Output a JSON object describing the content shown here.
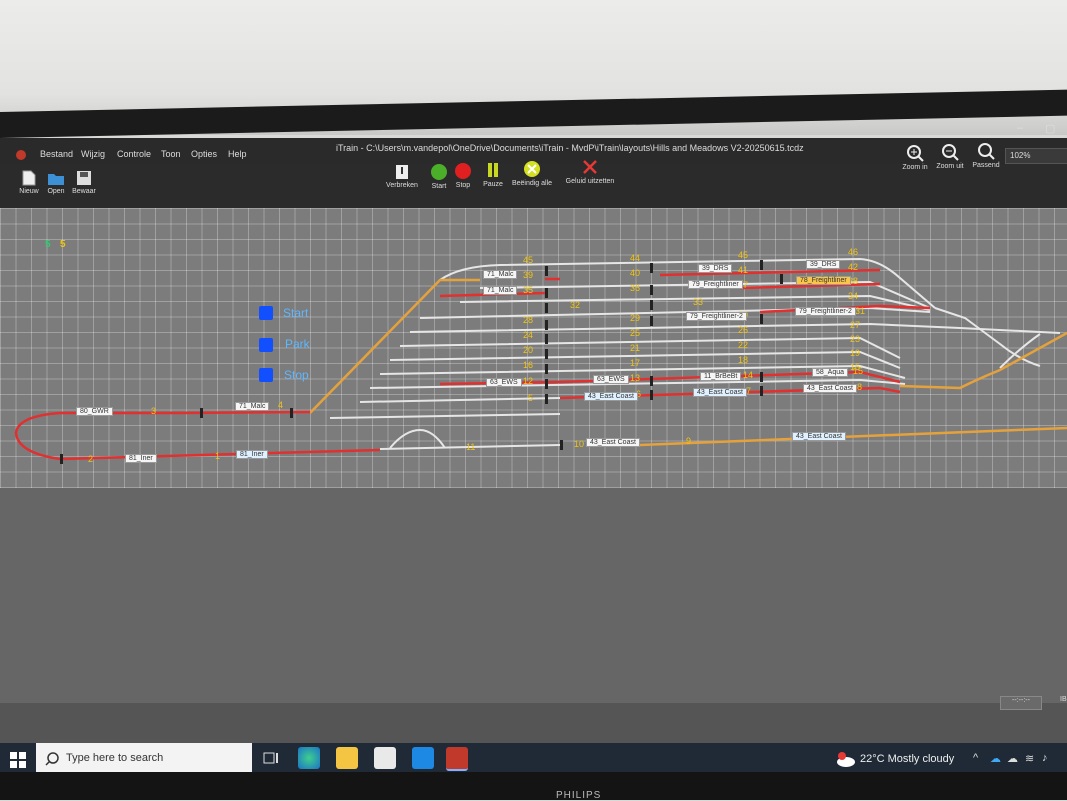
{
  "window": {
    "title": "iTrain - C:\\Users\\m.vandepol\\OneDrive\\Documents\\iTrain - MvdP\\iTrain\\layouts\\Hills and Meadows V2-20250615.tcdz",
    "menu": [
      "Bestand",
      "Wijzig",
      "Controle",
      "Toon",
      "Opties",
      "Help"
    ]
  },
  "toolbar": {
    "file": [
      {
        "label": "Nieuw",
        "icon": "new-file-icon"
      },
      {
        "label": "Open",
        "icon": "open-folder-icon"
      },
      {
        "label": "Bewaar",
        "icon": "save-icon"
      }
    ],
    "control": [
      {
        "label": "Verbreken",
        "icon": "disconnect-icon"
      },
      {
        "label": "Start",
        "icon": "green-light-icon"
      },
      {
        "label": "Stop",
        "icon": "red-light-icon"
      },
      {
        "label": "Pauze",
        "icon": "pause-icon"
      },
      {
        "label": "Beëindig alle",
        "icon": "end-all-icon"
      },
      {
        "label": "Geluid uitzetten",
        "icon": "mute-icon"
      }
    ],
    "view": [
      {
        "label": "Zoom in",
        "icon": "zoom-in-icon"
      },
      {
        "label": "Zoom uit",
        "icon": "zoom-out-icon"
      },
      {
        "label": "Passend",
        "icon": "fit-icon"
      }
    ],
    "zoom": "102%"
  },
  "counters": [
    "5",
    "5"
  ],
  "side_buttons": [
    "Start",
    "Park",
    "Stop"
  ],
  "blocks": [
    {
      "n": "45"
    },
    {
      "n": "44"
    },
    {
      "n": "46"
    },
    {
      "n": "45"
    },
    {
      "n": "39"
    },
    {
      "n": "40"
    },
    {
      "n": "41"
    },
    {
      "n": "42"
    },
    {
      "n": "35"
    },
    {
      "n": "36"
    },
    {
      "n": "37"
    },
    {
      "n": "38"
    },
    {
      "n": "34"
    },
    {
      "n": "32"
    },
    {
      "n": "33"
    },
    {
      "n": "31"
    },
    {
      "n": "28"
    },
    {
      "n": "29"
    },
    {
      "n": "30"
    },
    {
      "n": "27"
    },
    {
      "n": "24"
    },
    {
      "n": "25"
    },
    {
      "n": "26"
    },
    {
      "n": "23"
    },
    {
      "n": "20"
    },
    {
      "n": "21"
    },
    {
      "n": "22"
    },
    {
      "n": "19"
    },
    {
      "n": "16"
    },
    {
      "n": "17"
    },
    {
      "n": "18"
    },
    {
      "n": "15"
    },
    {
      "n": "12"
    },
    {
      "n": "13"
    },
    {
      "n": "14"
    },
    {
      "n": "15"
    },
    {
      "n": "5"
    },
    {
      "n": "6"
    },
    {
      "n": "7"
    },
    {
      "n": "8"
    },
    {
      "n": "3"
    },
    {
      "n": "4"
    },
    {
      "n": "2"
    },
    {
      "n": "1"
    },
    {
      "n": "11"
    },
    {
      "n": "10"
    },
    {
      "n": "9"
    }
  ],
  "trains": [
    {
      "name": "71_Malc"
    },
    {
      "name": "71_Malc"
    },
    {
      "name": "39_DRS"
    },
    {
      "name": "39_DRS"
    },
    {
      "name": "79_Freightliner"
    },
    {
      "name": "78_Freightliner"
    },
    {
      "name": "79_Freightliner-2"
    },
    {
      "name": "79_Freightliner-2"
    },
    {
      "name": "63_EWS"
    },
    {
      "name": "63_EWS"
    },
    {
      "name": "11_BrBeBt"
    },
    {
      "name": "58_Aqua"
    },
    {
      "name": "43_East Coast"
    },
    {
      "name": "43_East Coast"
    },
    {
      "name": "43_East Coast"
    },
    {
      "name": "80_GWR"
    },
    {
      "name": "71_Malc"
    },
    {
      "name": "81_Iner"
    },
    {
      "name": "81_Iner"
    },
    {
      "name": "43_East Coast"
    },
    {
      "name": "43_East Coast"
    }
  ],
  "status": {
    "time": "--:--:--",
    "ib": "IB"
  },
  "taskbar": {
    "search_placeholder": "Type here to search",
    "weather": "22°C  Mostly cloudy"
  },
  "brand": "PHILIPS"
}
